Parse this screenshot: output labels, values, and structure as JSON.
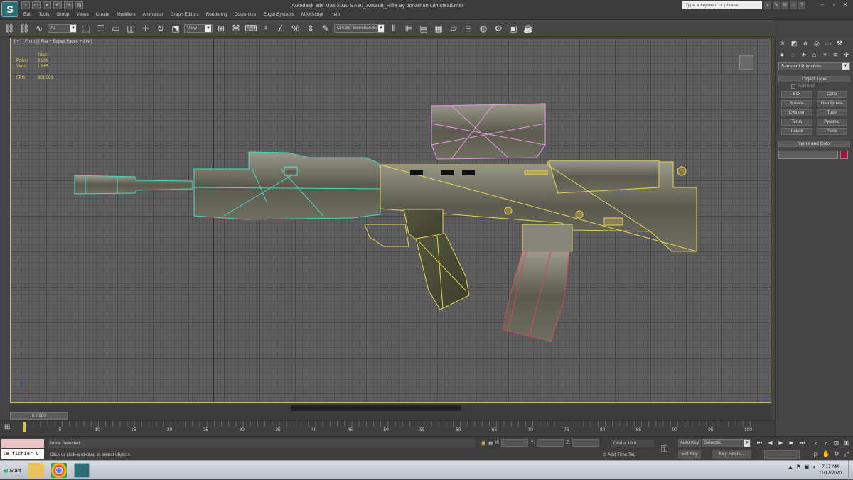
{
  "window": {
    "title": "Autodesk 3ds Max  2010       SA80_Assault_Rifle By Jonathan Olmstead.max",
    "search_placeholder": "Type a keyword or phrase"
  },
  "menu": [
    "Edit",
    "Tools",
    "Group",
    "Views",
    "Create",
    "Modifiers",
    "Animation",
    "Graph Editors",
    "Rendering",
    "Customize",
    "EugenSystems",
    "MAXScript",
    "Help"
  ],
  "toolbar": {
    "filter_dropdown": "All",
    "refcoord_dropdown": "View",
    "selection_set": "Create Selection Se"
  },
  "viewport": {
    "label": "[ + ] [ Front ] [ Flat + Edged Faces + XW ]",
    "stats": [
      {
        "key": "",
        "value": "Total"
      },
      {
        "key": "Polys:",
        "value": "2,209"
      },
      {
        "key": "Verts:",
        "value": "1,965"
      }
    ],
    "fps_key": "FPS:",
    "fps_value": "301.363"
  },
  "command_panel": {
    "primitive_dropdown": "Standard Primitives",
    "object_type_title": "Object Type",
    "autogrid_label": "AutoGrid",
    "object_buttons": [
      "Box",
      "Cone",
      "Sphere",
      "GeoSphere",
      "Cylinder",
      "Tube",
      "Torus",
      "Pyramid",
      "Teapot",
      "Plane"
    ],
    "name_color_title": "Name and Color",
    "object_color": "#a0163a"
  },
  "timeline": {
    "slider_label": "0 / 100",
    "ticks": [
      "5",
      "10",
      "15",
      "20",
      "25",
      "30",
      "35",
      "40",
      "45",
      "50",
      "55",
      "60",
      "65",
      "70",
      "75",
      "80",
      "85",
      "90",
      "95",
      "100"
    ],
    "current_frame": 0,
    "total_frames": 100
  },
  "status": {
    "maxscript_listener": "le fichier C",
    "selection": "None Selected",
    "prompt": "Click or click-and-drag to select objects",
    "x_label": "X:",
    "y_label": "Y:",
    "z_label": "Z:",
    "grid": "Grid = 10.0",
    "add_time_tag": "Add Time Tag",
    "auto_key": "Auto Key",
    "set_key": "Set Key",
    "key_mode": "Selected",
    "key_filters": "Key Filters..."
  },
  "taskbar": {
    "start_label": "Start",
    "time": "7:17 AM",
    "date": "11/17/2020"
  },
  "colors": {
    "accent_yellow": "#d8c846",
    "selection_cyan": "#4fd6c4",
    "selection_pink": "#e59be0",
    "selection_red": "#d24a5a",
    "wire_yellow": "#e6d35a"
  }
}
